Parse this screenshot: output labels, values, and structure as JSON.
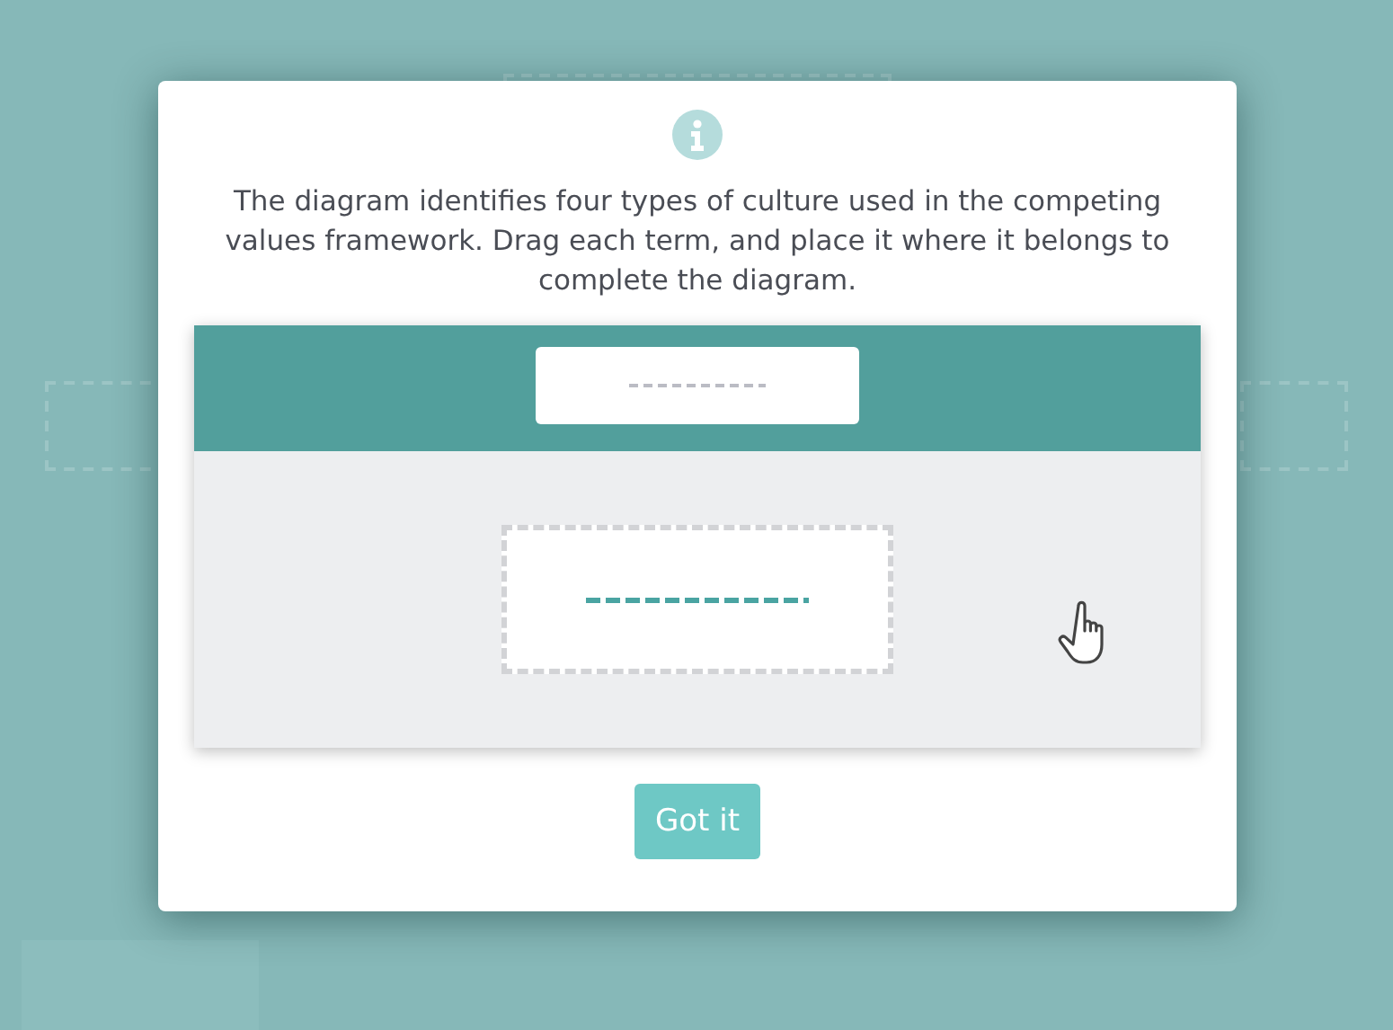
{
  "dialog": {
    "message": "The diagram identifies four types of culture used in the competing values framework. Drag each term, and place it where it belongs to complete the diagram.",
    "button": "Got it"
  }
}
